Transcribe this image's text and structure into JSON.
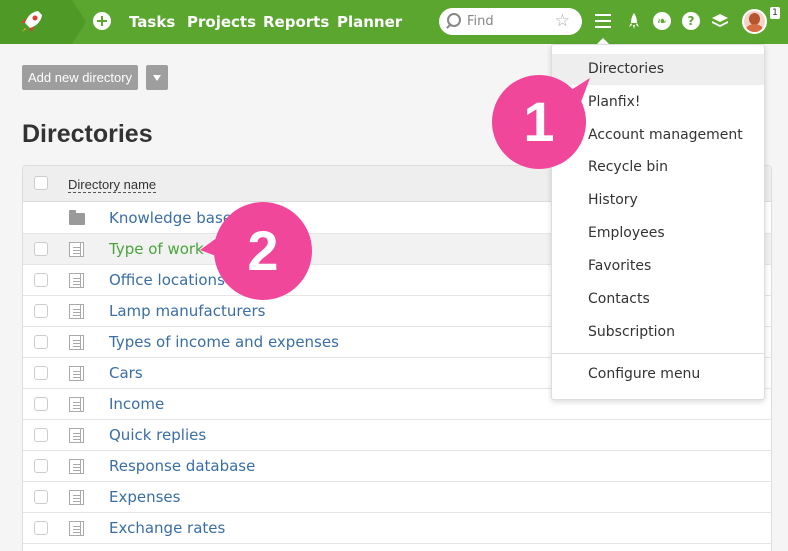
{
  "topbar": {
    "nav": [
      "Tasks",
      "Projects",
      "Reports",
      "Planner"
    ],
    "search_placeholder": "Find",
    "help_label": "?",
    "notification_count": "1"
  },
  "toolbar": {
    "add_label": "Add new directory"
  },
  "page": {
    "title": "Directories"
  },
  "table": {
    "header": "Directory name",
    "rows": [
      {
        "label": "Knowledge base",
        "icon": "folder-icon"
      },
      {
        "label": "Type of work",
        "icon": "document-icon"
      },
      {
        "label": "Office locations",
        "icon": "document-icon"
      },
      {
        "label": "Lamp manufacturers",
        "icon": "document-icon"
      },
      {
        "label": "Types of income and expenses",
        "icon": "document-icon"
      },
      {
        "label": "Cars",
        "icon": "document-icon"
      },
      {
        "label": "Income",
        "icon": "document-icon"
      },
      {
        "label": "Quick replies",
        "icon": "document-icon"
      },
      {
        "label": "Response database",
        "icon": "document-icon"
      },
      {
        "label": "Expenses",
        "icon": "document-icon"
      },
      {
        "label": "Exchange rates",
        "icon": "document-icon"
      }
    ]
  },
  "menu": {
    "items": [
      "Directories",
      "Planfix!",
      "Account management",
      "Recycle bin",
      "History",
      "Employees",
      "Favorites",
      "Contacts",
      "Subscription"
    ],
    "configure": "Configure menu"
  },
  "callouts": [
    "1",
    "2"
  ],
  "colors": {
    "topbar": "#5aa62f",
    "link": "#3a6ea5",
    "active_link": "#4aa43b",
    "callout": "#f0479b"
  }
}
